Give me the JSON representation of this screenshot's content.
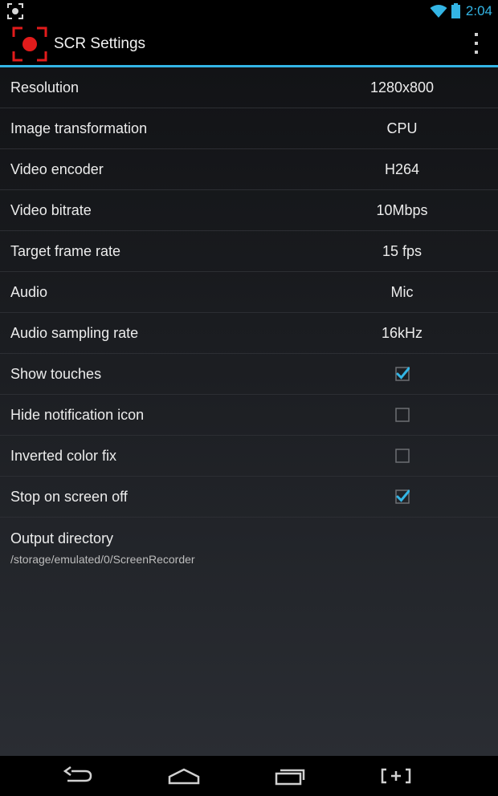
{
  "status_bar": {
    "time": "2:04",
    "left_icon": "screenshot-notification-icon",
    "icons": [
      "wifi-icon",
      "battery-icon"
    ]
  },
  "action_bar": {
    "title": "SCR Settings",
    "app_icon": "record-icon",
    "overflow_icon": "overflow-menu-icon"
  },
  "colors": {
    "accent": "#33b5e5",
    "app_icon_red": "#e21b1b",
    "background": "#000000"
  },
  "preferences": {
    "resolution": {
      "label": "Resolution",
      "value": "1280x800"
    },
    "image_transformation": {
      "label": "Image transformation",
      "value": "CPU"
    },
    "video_encoder": {
      "label": "Video encoder",
      "value": "H264"
    },
    "video_bitrate": {
      "label": "Video bitrate",
      "value": "10Mbps"
    },
    "target_frame_rate": {
      "label": "Target frame rate",
      "value": "15 fps"
    },
    "audio": {
      "label": "Audio",
      "value": "Mic"
    },
    "audio_sampling_rate": {
      "label": "Audio sampling rate",
      "value": "16kHz"
    },
    "show_touches": {
      "label": "Show touches",
      "checked": true
    },
    "hide_notification_icon": {
      "label": "Hide notification icon",
      "checked": false
    },
    "inverted_color_fix": {
      "label": "Inverted color fix",
      "checked": false
    },
    "stop_on_screen_off": {
      "label": "Stop on screen off",
      "checked": true
    },
    "output_directory": {
      "label": "Output directory",
      "summary": "/storage/emulated/0/ScreenRecorder"
    }
  },
  "nav_bar": {
    "buttons": [
      "back-icon",
      "home-icon",
      "recent-apps-icon",
      "screenshot-add-icon"
    ]
  }
}
